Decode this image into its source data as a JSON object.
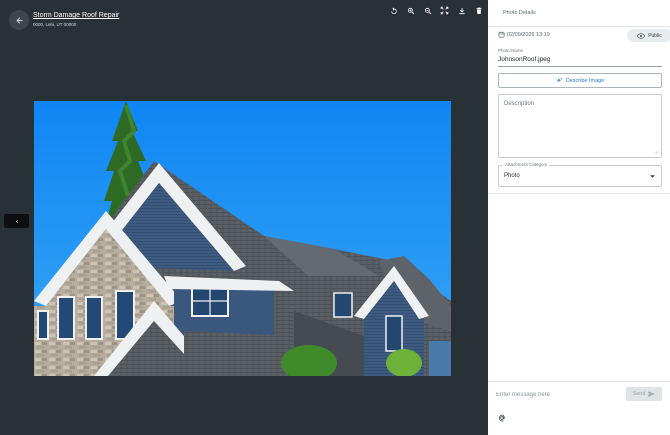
{
  "header": {
    "title": "Storm Damage Roof Repair",
    "address": "0000, Lehi, UT 00000"
  },
  "toolbar": {
    "icons": [
      "rotate-icon",
      "zoom-in-icon",
      "zoom-out-icon",
      "fit-screen-icon",
      "download-icon",
      "delete-icon"
    ]
  },
  "panel": {
    "title": "Photo Details",
    "date": "02/09/2026 13:19",
    "visibility": "Public",
    "photo_name_label": "Photo Name",
    "photo_name_value": "JohnsonRoof.jpeg",
    "describe_label": "Describe Image",
    "description_placeholder": "Description",
    "category_label": "Attachment Category",
    "category_value": "Photo"
  },
  "message": {
    "placeholder": "Enter message here",
    "send_label": "Send"
  },
  "colors": {
    "viewer_bg": "#283135",
    "accent": "#2c7cc8",
    "sky": "#1e8ff0"
  }
}
